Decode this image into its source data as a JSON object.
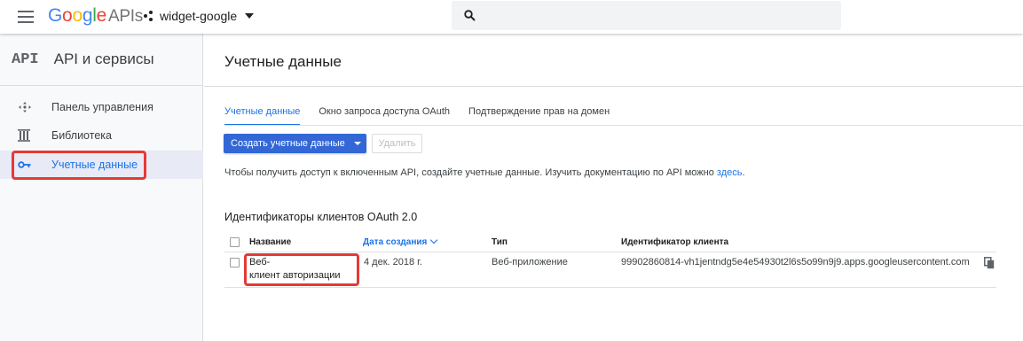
{
  "header": {
    "logo_google": "Google",
    "logo_apis": "APIs",
    "project_name": "widget-google",
    "search_placeholder": ""
  },
  "sidebar": {
    "mark": "API",
    "title": "API и сервисы",
    "items": [
      {
        "label": "Панель управления",
        "icon": "dashboard-icon"
      },
      {
        "label": "Библиотека",
        "icon": "library-icon"
      },
      {
        "label": "Учетные данные",
        "icon": "key-icon",
        "active": true
      }
    ]
  },
  "main": {
    "page_title": "Учетные данные",
    "tabs": [
      {
        "label": "Учетные данные",
        "active": true
      },
      {
        "label": "Окно запроса доступа OAuth"
      },
      {
        "label": "Подтверждение прав на домен"
      }
    ],
    "create_button": "Создать учетные данные",
    "delete_button": "Удалить",
    "info_text": "Чтобы получить доступ к включенным API, создайте учетные данные. Изучить документацию по API можно ",
    "info_link": "здесь",
    "info_end": ".",
    "section_title": "Идентификаторы клиентов OAuth 2.0",
    "table": {
      "columns": [
        "Название",
        "Дата создания",
        "Тип",
        "Идентификатор клиента"
      ],
      "rows": [
        {
          "name_line1": "Веб-",
          "name_line2": "клиент авторизации",
          "date": "4 дек. 2018 г.",
          "type": "Веб-приложение",
          "client_id": "99902860814-vh1jentndg5e4e54930t2l6s5o99n9j9.apps.googleusercontent.com"
        }
      ]
    }
  },
  "colors": {
    "accent": "#1a73e8",
    "button": "#3367d6",
    "highlight": "#e53935"
  }
}
